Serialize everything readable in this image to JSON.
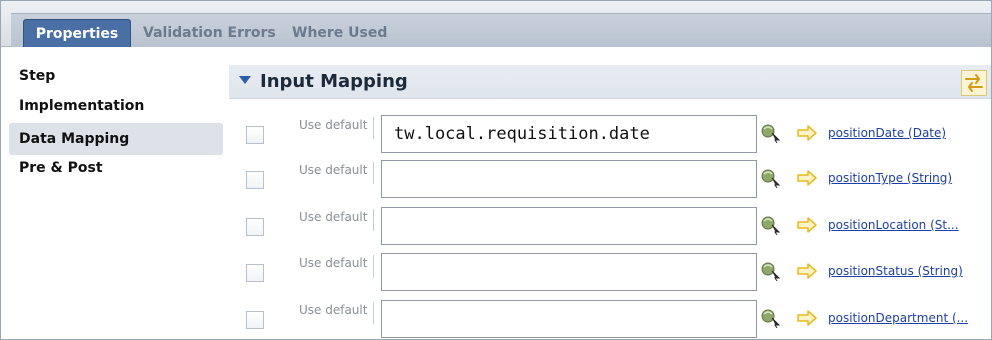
{
  "tabs": [
    {
      "label": "Properties",
      "active": true
    },
    {
      "label": "Validation Errors",
      "active": false
    },
    {
      "label": "Where Used",
      "active": false
    }
  ],
  "nav": {
    "items": [
      {
        "label": "Step",
        "selected": false
      },
      {
        "label": "Implementation",
        "selected": false
      },
      {
        "label": "Data Mapping",
        "selected": true
      },
      {
        "label": "Pre & Post",
        "selected": false
      }
    ]
  },
  "section": {
    "title": "Input Mapping"
  },
  "mappings": [
    {
      "use_default_label": "Use default",
      "checked": false,
      "value": "tw.local.requisition.date",
      "param": "positionDate (Date)"
    },
    {
      "use_default_label": "Use default",
      "checked": false,
      "value": "",
      "param": "positionType (String)"
    },
    {
      "use_default_label": "Use default",
      "checked": false,
      "value": "",
      "param": "positionLocation (St..."
    },
    {
      "use_default_label": "Use default",
      "checked": false,
      "value": "",
      "param": "positionStatus (String)"
    },
    {
      "use_default_label": "Use default",
      "checked": false,
      "value": "",
      "param": "positionDepartment (..."
    }
  ],
  "colors": {
    "active_tab": "#4a6fa5",
    "link": "#1f3fa6",
    "arrow": "#e8b820",
    "caret": "#2d5fa4"
  },
  "icons": {
    "variable": "variable-picker-icon",
    "arrow": "mapping-arrow-icon",
    "swap": "swap-icon",
    "collapse": "collapse-caret-icon"
  }
}
